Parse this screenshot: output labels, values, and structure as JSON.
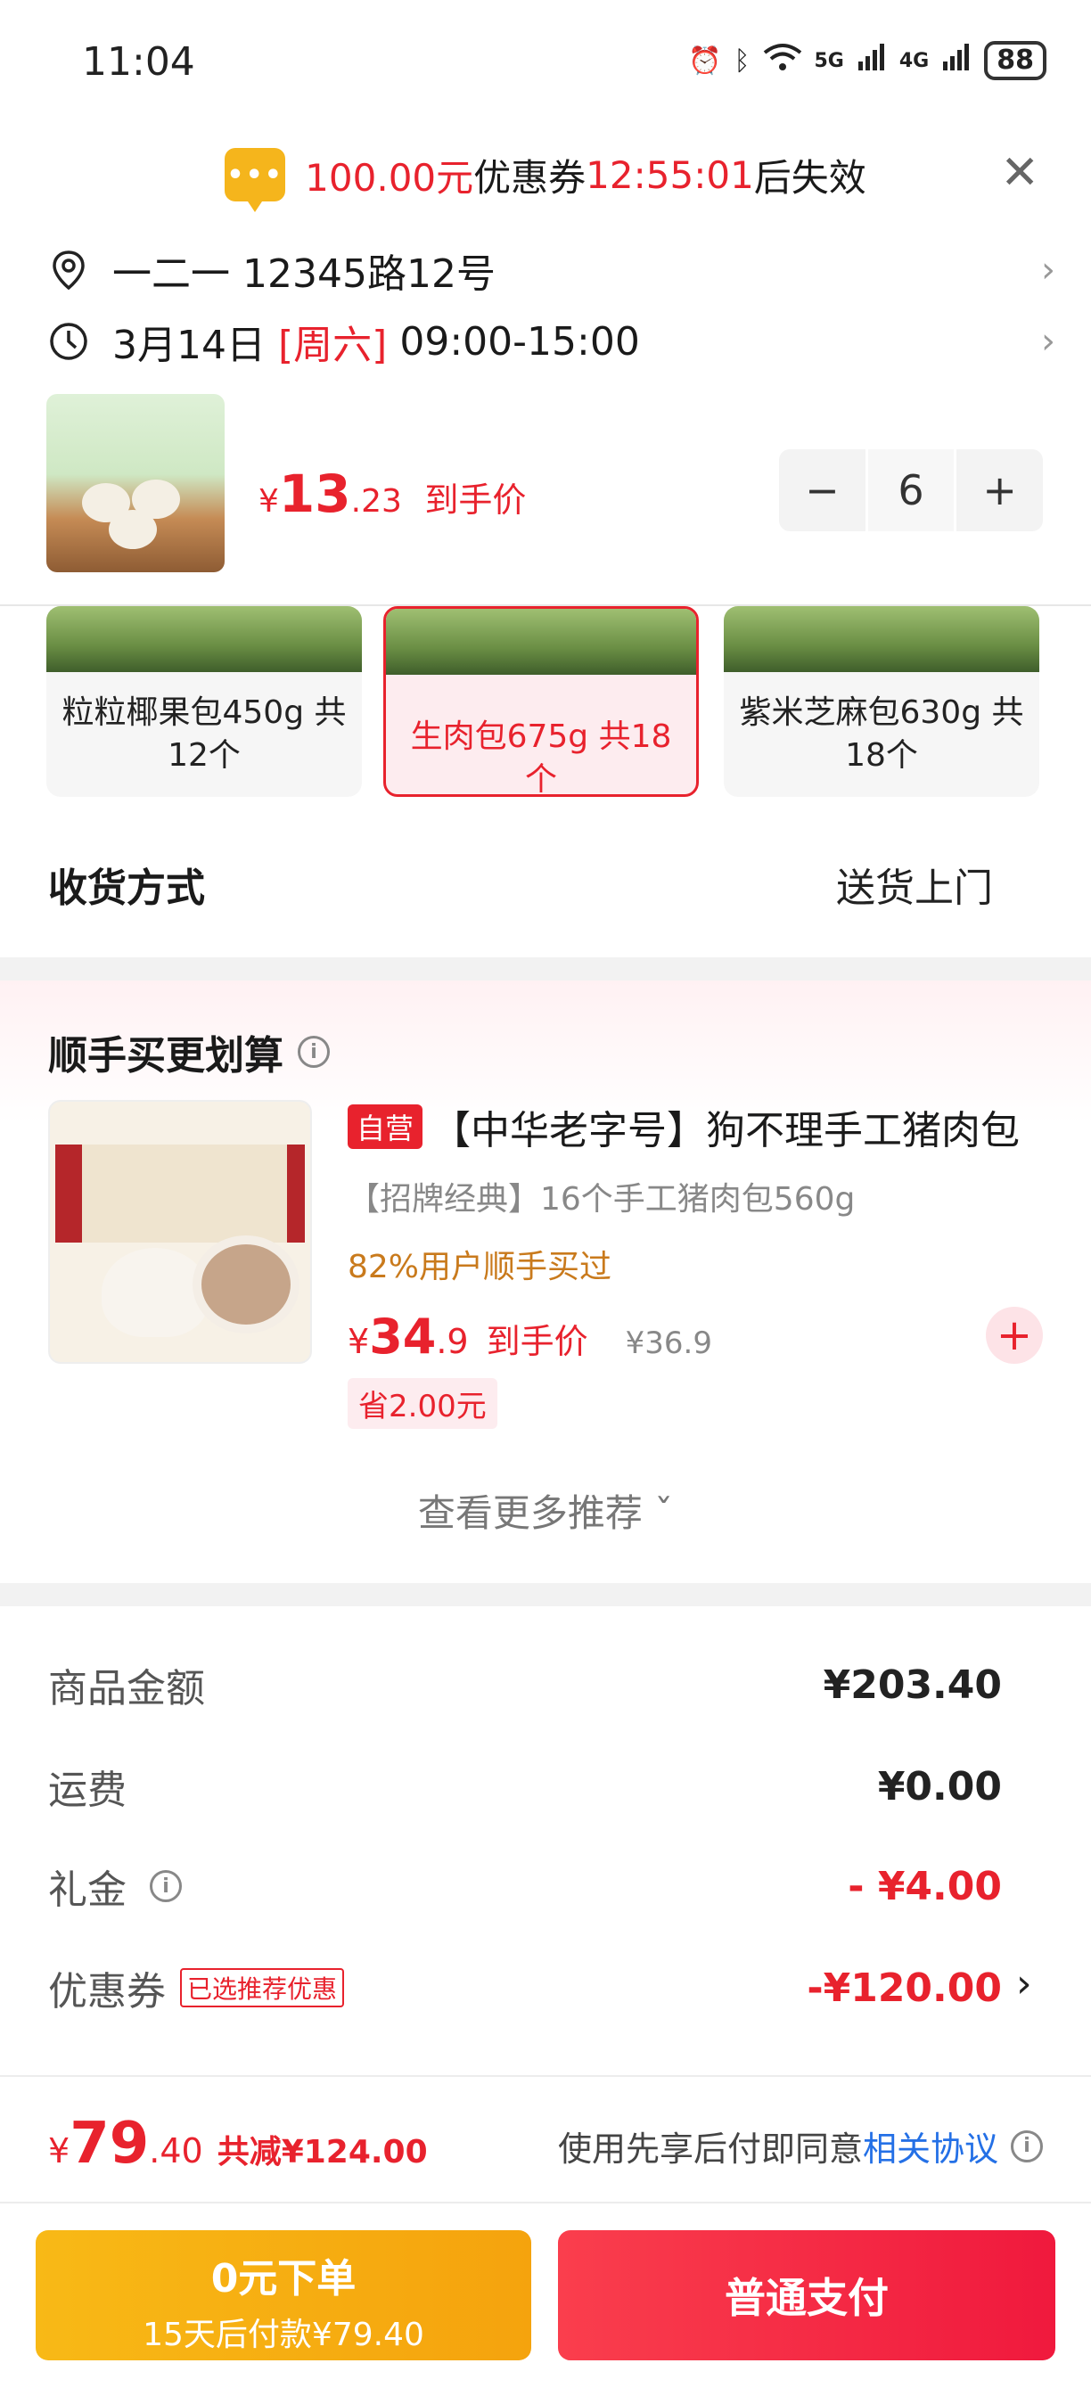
{
  "status_bar": {
    "time": "11:04",
    "battery": "88",
    "signal_1": "5G",
    "signal_2": "4G"
  },
  "coupon_bar": {
    "amount": "100.00元",
    "text": "优惠券",
    "countdown": "12:55:01",
    "suffix": "后失效",
    "icon": "chat-bubble-icon"
  },
  "address": {
    "text": "一二一  12345路12号"
  },
  "delivery_time": {
    "date": "3月14日",
    "weekday": "[周六]",
    "time": "09:00-15:00"
  },
  "product": {
    "currency": "¥",
    "price_int": "13",
    "price_dec": ".23",
    "price_label": "到手价",
    "quantity": "6"
  },
  "variants": [
    {
      "label": "粒粒椰果包450g 共12个",
      "selected": false
    },
    {
      "label": "生肉包675g 共18个",
      "selected": true
    },
    {
      "label": "紫米芝麻包630g 共18个",
      "selected": false
    }
  ],
  "delivery": {
    "title": "收货方式",
    "value": "送货上门"
  },
  "recommend": {
    "title": "顺手买更划算",
    "tag": "自营",
    "name": "【中华老字号】狗不理手工猪肉包",
    "subtitle": "【招牌经典】16个手工猪肉包560g",
    "bought": "82%用户顺手买过",
    "currency": "¥",
    "price_int": "34",
    "price_dec": ".9",
    "price_label": "到手价",
    "orig_price": "¥36.9",
    "save": "省2.00元",
    "more": "查看更多推荐 ˇ"
  },
  "summary": {
    "goods_label": "商品金额",
    "goods_value": "¥203.40",
    "shipping_label": "运费",
    "shipping_value": "¥0.00",
    "gift_label": "礼金",
    "gift_value": "- ¥4.00",
    "coupon_label": "优惠券",
    "coupon_badge": "已选推荐优惠",
    "coupon_value": "-¥120.00"
  },
  "bottom": {
    "currency": "¥",
    "total_int": "79",
    "total_dec": ".40",
    "discount": "共减¥124.00",
    "agree_text": "使用先享后付即同意",
    "agree_link": "相关协议",
    "btn_zero_l1": "0元下单",
    "btn_zero_l2": "15天后付款¥79.40",
    "btn_pay": "普通支付"
  },
  "colors": {
    "accent_red": "#e8222d",
    "button_yellow": "#f8b916",
    "link_blue": "#2470e6"
  }
}
